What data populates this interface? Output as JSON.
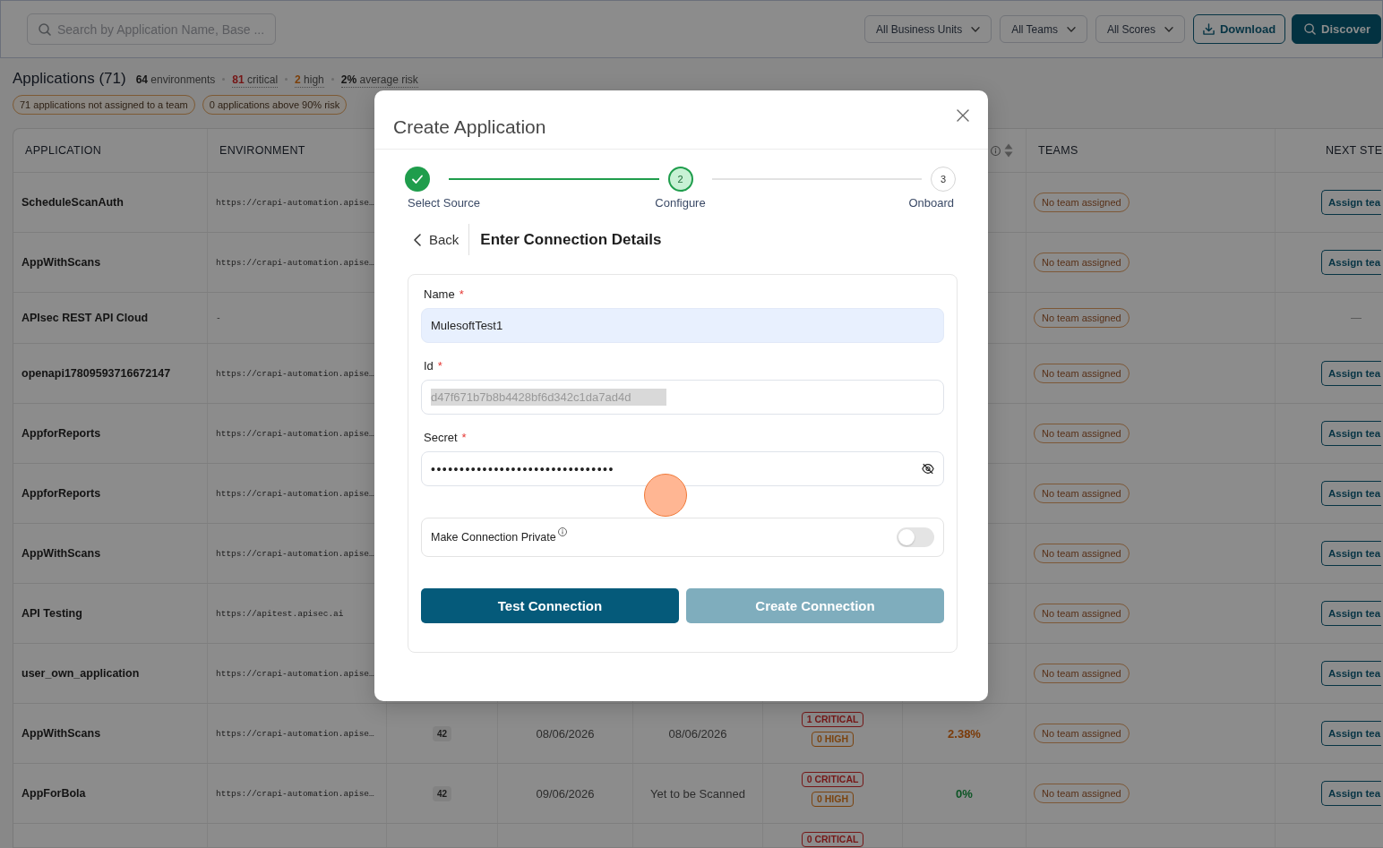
{
  "top_bar": {
    "search": {
      "placeholder": "Search by Application Name, Base ..."
    },
    "filters": [
      {
        "label": "All Business Units"
      },
      {
        "label": "All Teams"
      },
      {
        "label": "All Scores"
      }
    ],
    "actions": [
      {
        "label": "Download",
        "kind": "download"
      },
      {
        "label": "Discover",
        "kind": "discover"
      }
    ]
  },
  "summary": {
    "title": "Applications (71)",
    "stats": [
      {
        "text": "**64** environments",
        "kind": "count"
      },
      {
        "text": "**81** critical",
        "kind": "critical"
      },
      {
        "text": "**2** high",
        "kind": "high"
      },
      {
        "text": "**2%** average risk",
        "kind": "risk"
      }
    ],
    "alerts": [
      "71 applications not assigned to a team",
      "0 applications above 90% risk"
    ]
  },
  "table": {
    "header": {
      "application": "APPLICATION",
      "environment": "ENVIRONMENT",
      "teams": "TEAMS",
      "next_step": "NEXT STE"
    },
    "rows": [
      {
        "application": "ScheduleScanAuth",
        "environment": "https://crapi-automation.apise…",
        "teams": "No team assigned",
        "next_step": {
          "kind": "button",
          "label": "Assign tea"
        }
      },
      {
        "application": "AppWithScans",
        "environment": "https://crapi-automation.apise…",
        "teams": "No team assigned",
        "next_step": {
          "kind": "button",
          "label": "Assign tea"
        }
      },
      {
        "application": "APIsec REST API Cloud",
        "environment": "-",
        "teams": "No team assigned",
        "next_step": {
          "kind": "none",
          "label": "—"
        }
      },
      {
        "application": "openapi17809593716672147",
        "environment": "https://crapi-automation.apise…",
        "teams": "No team assigned",
        "next_step": {
          "kind": "button",
          "label": "Assign tea"
        }
      },
      {
        "application": "AppforReports",
        "environment": "https://crapi-automation.apise…",
        "teams": "No team assigned",
        "next_step": {
          "kind": "button",
          "label": "Assign tea"
        }
      },
      {
        "application": "AppforReports",
        "environment": "https://crapi-automation.apise…",
        "teams": "No team assigned",
        "next_step": {
          "kind": "button",
          "label": "Assign tea"
        }
      },
      {
        "application": "AppWithScans",
        "environment": "https://crapi-automation.apise…",
        "teams": "No team assigned",
        "next_step": {
          "kind": "button",
          "label": "Assign tea"
        }
      },
      {
        "application": "API Testing",
        "environment": "https://apitest.apisec.ai",
        "teams": "No team assigned",
        "next_step": {
          "kind": "button",
          "label": "Assign tea"
        }
      },
      {
        "application": "user_own_application",
        "environment": "https://crapi-automation.apise…",
        "teams": "No team assigned",
        "next_step": {
          "kind": "button",
          "label": "Assign tea"
        }
      },
      {
        "application": "AppWithScans",
        "environment": "https://crapi-automation.apise…",
        "column_3": "42",
        "column_4": "08/06/2026",
        "column_5": "08/06/2026",
        "column_6": [
          {
            "label": "1 CRITICAL",
            "kind": "critical"
          },
          {
            "label": "0 HIGH",
            "kind": "high"
          }
        ],
        "column_7": {
          "value": "2.38%",
          "color": "#7b3b09"
        },
        "teams": "No team assigned",
        "next_step": {
          "kind": "button",
          "label": "Assign tea"
        }
      },
      {
        "application": "AppForBola",
        "environment": "https://crapi-automation.apise…",
        "column_3": "42",
        "column_4": "09/06/2026",
        "column_5": "Yet to be Scanned",
        "column_6": [
          {
            "label": "0 CRITICAL",
            "kind": "critical"
          },
          {
            "label": "0 HIGH",
            "kind": "high"
          }
        ],
        "column_7": {
          "value": "0%",
          "color": "#0d5525"
        },
        "teams": "No team assigned",
        "next_step": {
          "kind": "button",
          "label": "Assign tea"
        }
      },
      {
        "column_6": [
          {
            "label": "0 CRITICAL",
            "kind": "critical"
          }
        ]
      }
    ]
  },
  "dialog": {
    "title": "Create Application",
    "steps": [
      {
        "label": "Select Source",
        "completed": true,
        "current": false
      },
      {
        "label": "Configure",
        "number": "2",
        "completed": false,
        "current": true
      },
      {
        "label": "Onboard",
        "number": "3",
        "completed": false,
        "current": false
      }
    ],
    "back": "Back",
    "heading": "Enter Connection Details",
    "fields": [
      {
        "kind": "text",
        "label": "Name",
        "required_mark": "*",
        "value": "MulesoftTest1",
        "autofilled": true,
        "value_selected": false
      },
      {
        "kind": "text",
        "label": "Id",
        "required_mark": "*",
        "value": "d47f671b7b8b4428bf6d342c1da7ad4d",
        "autofilled": false,
        "value_selected": true
      },
      {
        "kind": "password",
        "label": "Secret",
        "required_mark": "*",
        "value": "••••••••••••••••••••••••••••••••",
        "autofilled": false,
        "value_selected": false,
        "revealed": false
      }
    ],
    "private_toggle": {
      "label": "Make Connection Private",
      "on": false
    },
    "buttons": [
      {
        "label": "Test Connection",
        "disabled": false
      },
      {
        "label": "Create Connection",
        "disabled": true
      }
    ]
  }
}
